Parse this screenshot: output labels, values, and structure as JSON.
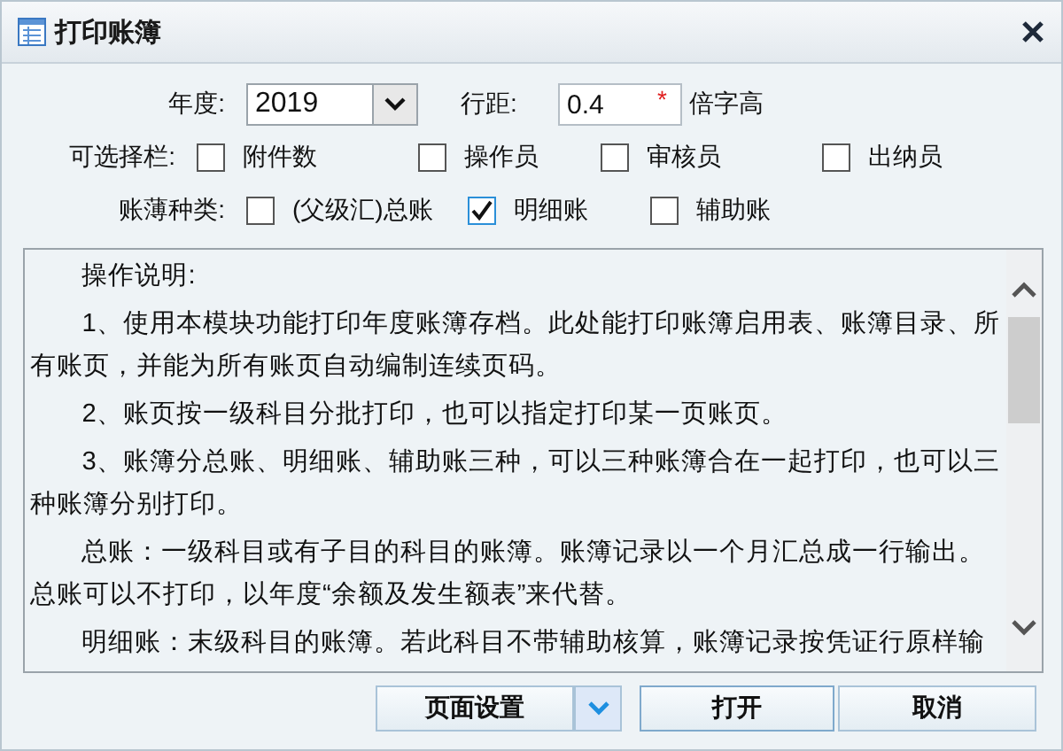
{
  "window": {
    "title": "打印账簿"
  },
  "year": {
    "label": "年度:",
    "value": "2019"
  },
  "line_spacing": {
    "label": "行距:",
    "value": "0.4",
    "required_mark": "*",
    "unit": "倍字高"
  },
  "optional_columns": {
    "label": "可选择栏:",
    "options": [
      {
        "label": "附件数",
        "checked": false
      },
      {
        "label": "操作员",
        "checked": false
      },
      {
        "label": "审核员",
        "checked": false
      },
      {
        "label": "出纳员",
        "checked": false
      }
    ]
  },
  "ledger_types": {
    "label": "账薄种类:",
    "options": [
      {
        "label": "(父级汇)总账",
        "checked": false
      },
      {
        "label": "明细账",
        "checked": true
      },
      {
        "label": "辅助账",
        "checked": false
      }
    ]
  },
  "instructions": [
    "操作说明:",
    "1、使用本模块功能打印年度账簿存档。此处能打印账簿启用表、账簿目录、所有账页，并能为所有账页自动编制连续页码。",
    "2、账页按一级科目分批打印，也可以指定打印某一页账页。",
    "3、账簿分总账、明细账、辅助账三种，可以三种账簿合在一起打印，也可以三种账簿分别打印。",
    "总账：一级科目或有子目的科目的账簿。账簿记录以一个月汇总成一行输出。总账可以不打印，以年度“余额及发生额表”来代替。",
    "明细账：末级科目的账簿。若此科目不带辅助核算，账簿记录按凭证行原样输"
  ],
  "buttons": {
    "page_setup": "页面设置",
    "open": "打开",
    "cancel": "取消"
  }
}
